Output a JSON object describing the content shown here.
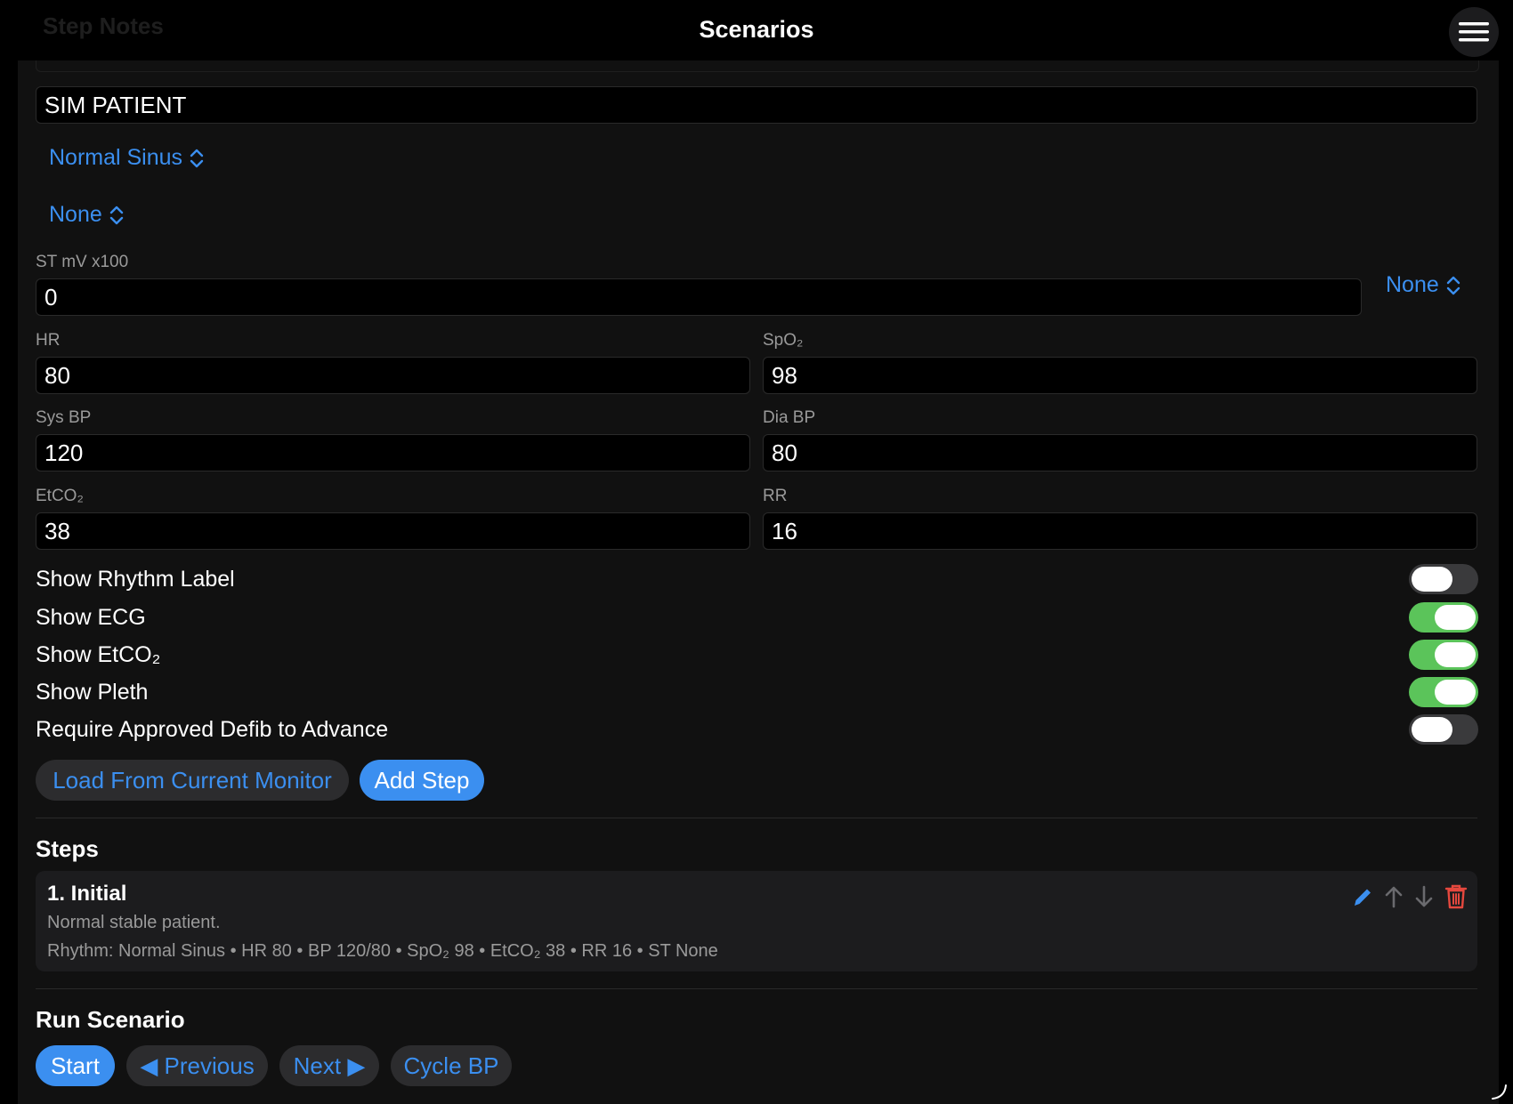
{
  "header": {
    "title": "Scenarios",
    "ghost_section": "Step Notes"
  },
  "form": {
    "patient_name": "SIM PATIENT",
    "rhythm_picker": "Normal Sinus",
    "second_picker": "None",
    "st_label": "ST mV x100",
    "st_value": "0",
    "st_picker": "None",
    "hr_label": "HR",
    "hr_value": "80",
    "spo2_label": "SpO₂",
    "spo2_value": "98",
    "sys_label": "Sys BP",
    "sys_value": "120",
    "dia_label": "Dia BP",
    "dia_value": "80",
    "etco2_label": "EtCO₂",
    "etco2_value": "38",
    "rr_label": "RR",
    "rr_value": "16"
  },
  "toggles": [
    {
      "label": "Show Rhythm Label",
      "on": false
    },
    {
      "label": "Show ECG",
      "on": true
    },
    {
      "label": "Show EtCO₂",
      "on": true
    },
    {
      "label": "Show Pleth",
      "on": true
    },
    {
      "label": "Require Approved Defib to Advance",
      "on": false
    }
  ],
  "actions": {
    "load_label": "Load From Current Monitor",
    "add_label": "Add Step"
  },
  "steps": {
    "title": "Steps",
    "items": [
      {
        "title": "1. Initial",
        "notes": "Normal stable patient.",
        "summary": "Rhythm: Normal Sinus • HR 80 • BP 120/80 • SpO₂ 98 • EtCO₂ 38 • RR 16 • ST None"
      }
    ]
  },
  "run": {
    "title": "Run Scenario",
    "start_label": "Start",
    "previous_label": "◀ Previous",
    "next_label": "Next ▶",
    "cycle_label": "Cycle BP"
  },
  "colors": {
    "accent": "#3b8ff0",
    "toggle_on": "#5bc45a",
    "delete": "#e5483e"
  }
}
